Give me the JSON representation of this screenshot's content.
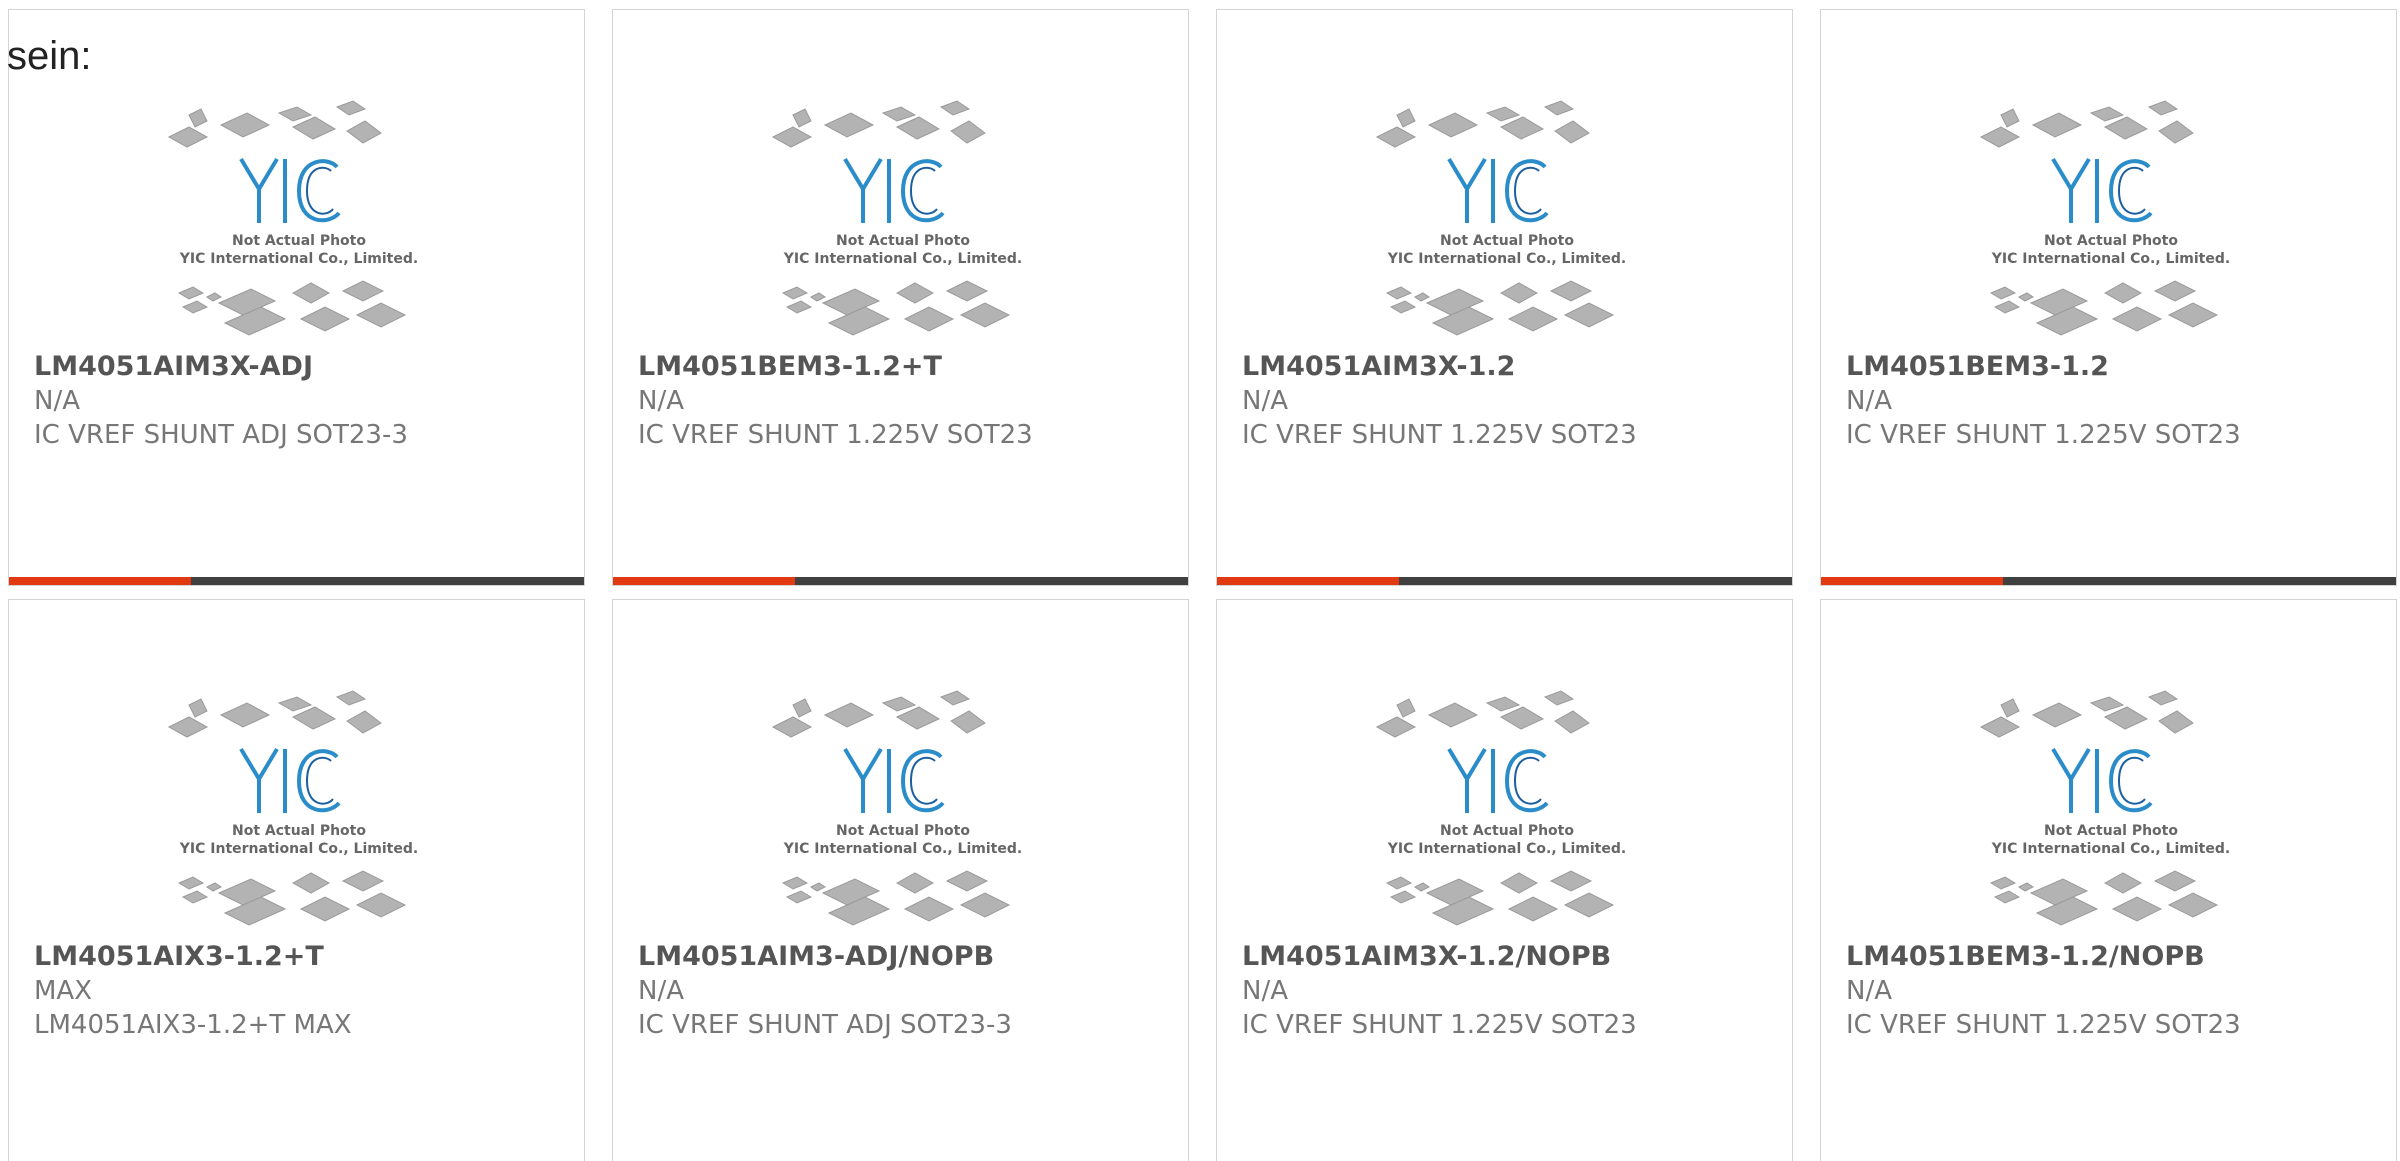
{
  "lead_text": "sein:",
  "placeholder": {
    "line1": "Not Actual Photo",
    "line2": "YIC International Co., Limited.",
    "logo_text": "YIC"
  },
  "colors": {
    "accent": "#e13a12",
    "bar_dark": "#404040",
    "logo_blue": "#2a8cc8",
    "chip_gray": "#b0b0b0"
  },
  "products": [
    {
      "part": "LM4051AIM3X-ADJ",
      "manufacturer": "N/A",
      "description": "IC VREF SHUNT ADJ SOT23-3"
    },
    {
      "part": "LM4051BEM3-1.2+T",
      "manufacturer": "N/A",
      "description": "IC VREF SHUNT 1.225V SOT23"
    },
    {
      "part": "LM4051AIM3X-1.2",
      "manufacturer": "N/A",
      "description": "IC VREF SHUNT 1.225V SOT23"
    },
    {
      "part": "LM4051BEM3-1.2",
      "manufacturer": "N/A",
      "description": "IC VREF SHUNT 1.225V SOT23"
    },
    {
      "part": "LM4051AIX3-1.2+T",
      "manufacturer": "MAX",
      "description": "LM4051AIX3-1.2+T MAX"
    },
    {
      "part": "LM4051AIM3-ADJ/NOPB",
      "manufacturer": "N/A",
      "description": "IC VREF SHUNT ADJ SOT23-3"
    },
    {
      "part": "LM4051AIM3X-1.2/NOPB",
      "manufacturer": "N/A",
      "description": "IC VREF SHUNT 1.225V SOT23"
    },
    {
      "part": "LM4051BEM3-1.2/NOPB",
      "manufacturer": "N/A",
      "description": "IC VREF SHUNT 1.225V SOT23"
    }
  ]
}
